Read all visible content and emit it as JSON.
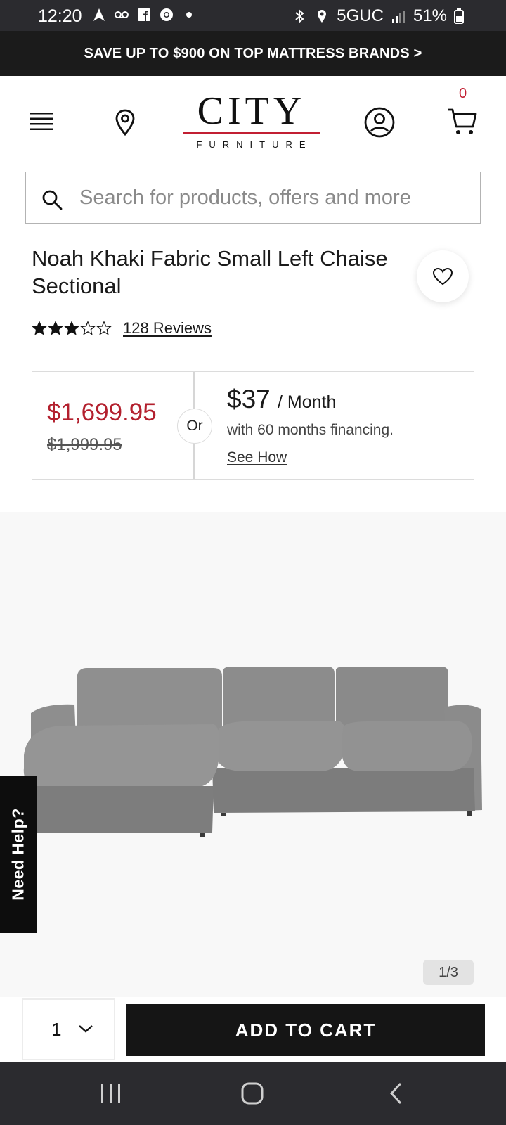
{
  "status_bar": {
    "time": "12:20",
    "network": "5GUC",
    "battery": "51%"
  },
  "promo": {
    "text": "SAVE UP TO $900 ON TOP MATTRESS BRANDS >"
  },
  "header": {
    "logo_main": "CITY",
    "logo_sub": "FURNITURE",
    "cart_count": "0"
  },
  "search": {
    "placeholder": "Search for products, offers and more"
  },
  "product": {
    "title": "Noah Khaki Fabric Small Left Chaise Sectional",
    "rating": 3,
    "rating_max": 5,
    "reviews_label": "128 Reviews"
  },
  "pricing": {
    "sale_price": "$1,699.95",
    "original_price": "$1,999.95",
    "or_label": "Or",
    "monthly_amount": "$37",
    "monthly_unit": "/ Month",
    "financing_desc": "with 60 months financing.",
    "see_how": "See How"
  },
  "gallery": {
    "counter": "1/3"
  },
  "need_help": {
    "label": "Need Help?"
  },
  "purchase": {
    "quantity": "1",
    "add_to_cart": "ADD TO CART"
  },
  "colors": {
    "accent_red": "#b3202e",
    "dark": "#151515"
  }
}
